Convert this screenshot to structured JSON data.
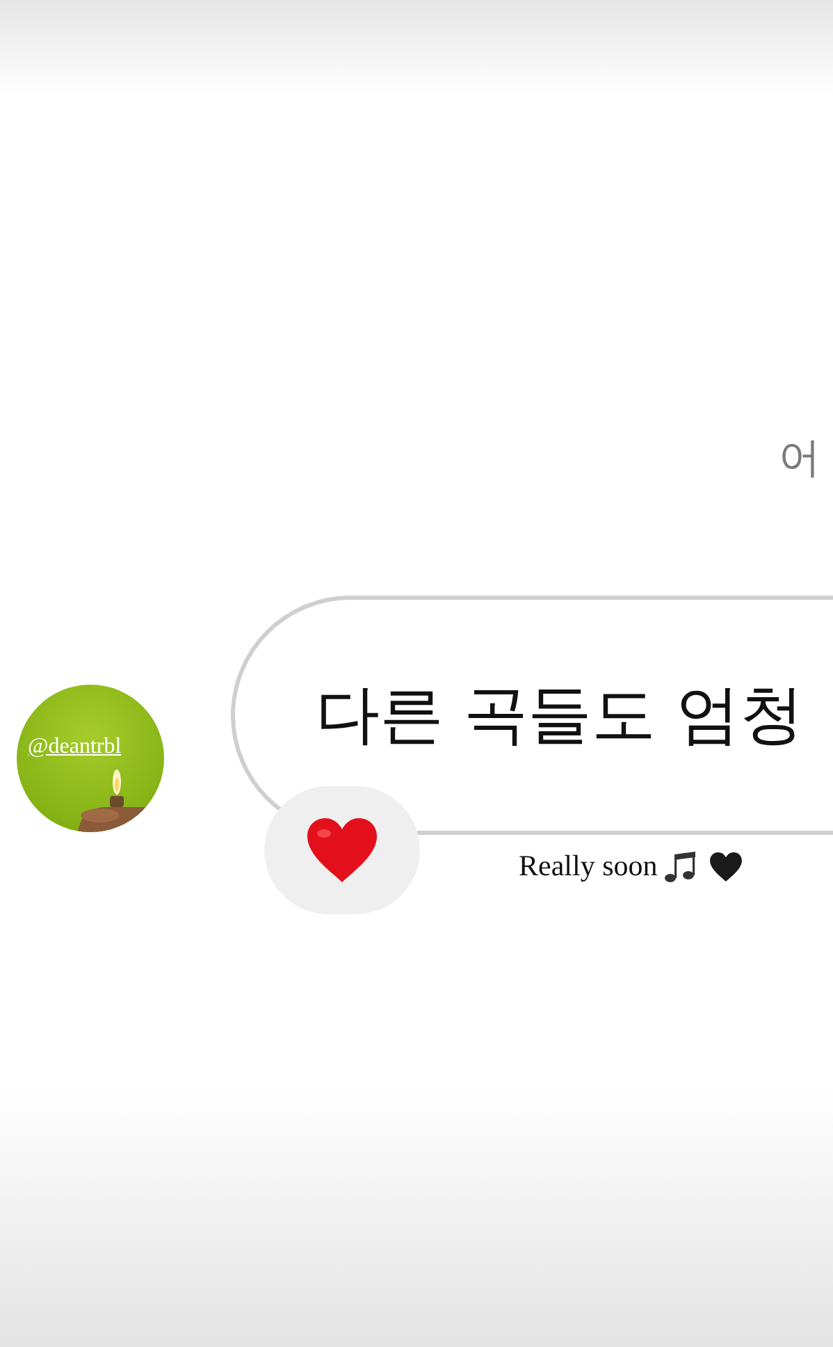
{
  "partial_message": {
    "text": "어"
  },
  "message": {
    "text": "다른 곡들도 엄청"
  },
  "sender": {
    "mention": "@deantrbl"
  },
  "caption": {
    "text": "Really soon"
  }
}
